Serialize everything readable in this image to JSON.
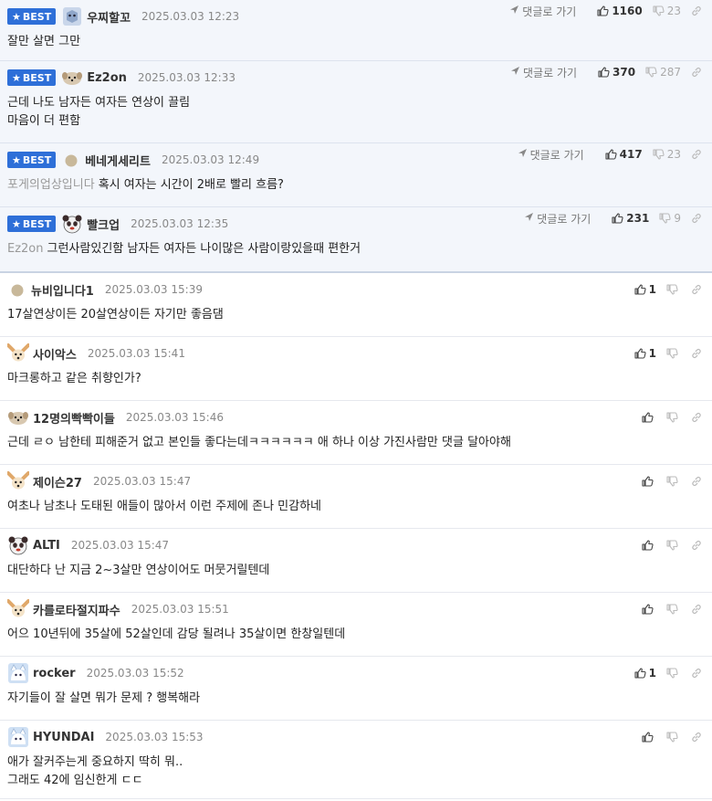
{
  "ui": {
    "best_label": "BEST",
    "goto_label": "댓글로 가기"
  },
  "comments": [
    {
      "nick": "우찌할꼬",
      "date": "2025.03.03 12:23",
      "lines": [
        "잘만 살면 그만"
      ],
      "reply_to": "",
      "up": "1160",
      "down": "23",
      "best": true,
      "avatar": "cube"
    },
    {
      "nick": "Ez2on",
      "date": "2025.03.03 12:33",
      "lines": [
        "근데 나도 남자든 여자든 연상이 끌림",
        "마음이 더 편함"
      ],
      "reply_to": "",
      "up": "370",
      "down": "287",
      "best": true,
      "avatar": "dog"
    },
    {
      "nick": "베네게세리트",
      "date": "2025.03.03 12:49",
      "lines": [
        "혹시 여자는 시간이 2배로 빨리 흐름?"
      ],
      "reply_to": "포게의업상입니다",
      "up": "417",
      "down": "23",
      "best": true,
      "avatar": "dot"
    },
    {
      "nick": "빨크업",
      "date": "2025.03.03 12:35",
      "lines": [
        "그런사람있긴함 남자든 여자든 나이많은 사람이랑있을때 편한거"
      ],
      "reply_to": "Ez2on",
      "up": "231",
      "down": "9",
      "best": true,
      "avatar": "panda"
    },
    {
      "nick": "뉴비입니다1",
      "date": "2025.03.03 15:39",
      "lines": [
        "17살연상이든 20살연상이든 자기만 좋음댐"
      ],
      "reply_to": "",
      "up": "1",
      "down": "",
      "best": false,
      "avatar": "dot"
    },
    {
      "nick": "사이악스",
      "date": "2025.03.03 15:41",
      "lines": [
        "마크롱하고 같은 취향인가?"
      ],
      "reply_to": "",
      "up": "1",
      "down": "",
      "best": false,
      "avatar": "fennec"
    },
    {
      "nick": "12명의빡빡이들",
      "date": "2025.03.03 15:46",
      "lines": [
        "근데 ㄹㅇ 남한테 피해준거 없고 본인들 좋다는데ㅋㅋㅋㅋㅋㅋ 애 하나 이상 가진사람만 댓글 달아야해"
      ],
      "reply_to": "",
      "up": "",
      "down": "",
      "best": false,
      "avatar": "dog"
    },
    {
      "nick": "제이슨27",
      "date": "2025.03.03 15:47",
      "lines": [
        "여초나 남초나 도태된 애들이 많아서 이런 주제에 존나 민감하네"
      ],
      "reply_to": "",
      "up": "",
      "down": "",
      "best": false,
      "avatar": "fennec"
    },
    {
      "nick": "ALTI",
      "date": "2025.03.03 15:47",
      "lines": [
        "대단하다 난 지금 2~3살만 연상이어도 머뭇거릴텐데"
      ],
      "reply_to": "",
      "up": "",
      "down": "",
      "best": false,
      "avatar": "panda"
    },
    {
      "nick": "카를로타절지파수",
      "date": "2025.03.03 15:51",
      "lines": [
        "어으 10년뒤에 35살에 52살인데 감당 될려나 35살이면 한창일텐데"
      ],
      "reply_to": "",
      "up": "",
      "down": "",
      "best": false,
      "avatar": "fennec"
    },
    {
      "nick": "rocker",
      "date": "2025.03.03 15:52",
      "lines": [
        "자기들이 잘 살면 뭐가 문제 ? 행복해라"
      ],
      "reply_to": "",
      "up": "1",
      "down": "",
      "best": false,
      "avatar": "cat"
    },
    {
      "nick": "HYUNDAI",
      "date": "2025.03.03 15:53",
      "lines": [
        "애가 잘커주는게 중요하지 딱히 뭐..",
        "그래도 42에 임신한게 ㄷㄷ"
      ],
      "reply_to": "",
      "up": "",
      "down": "",
      "best": false,
      "avatar": "cat"
    }
  ]
}
